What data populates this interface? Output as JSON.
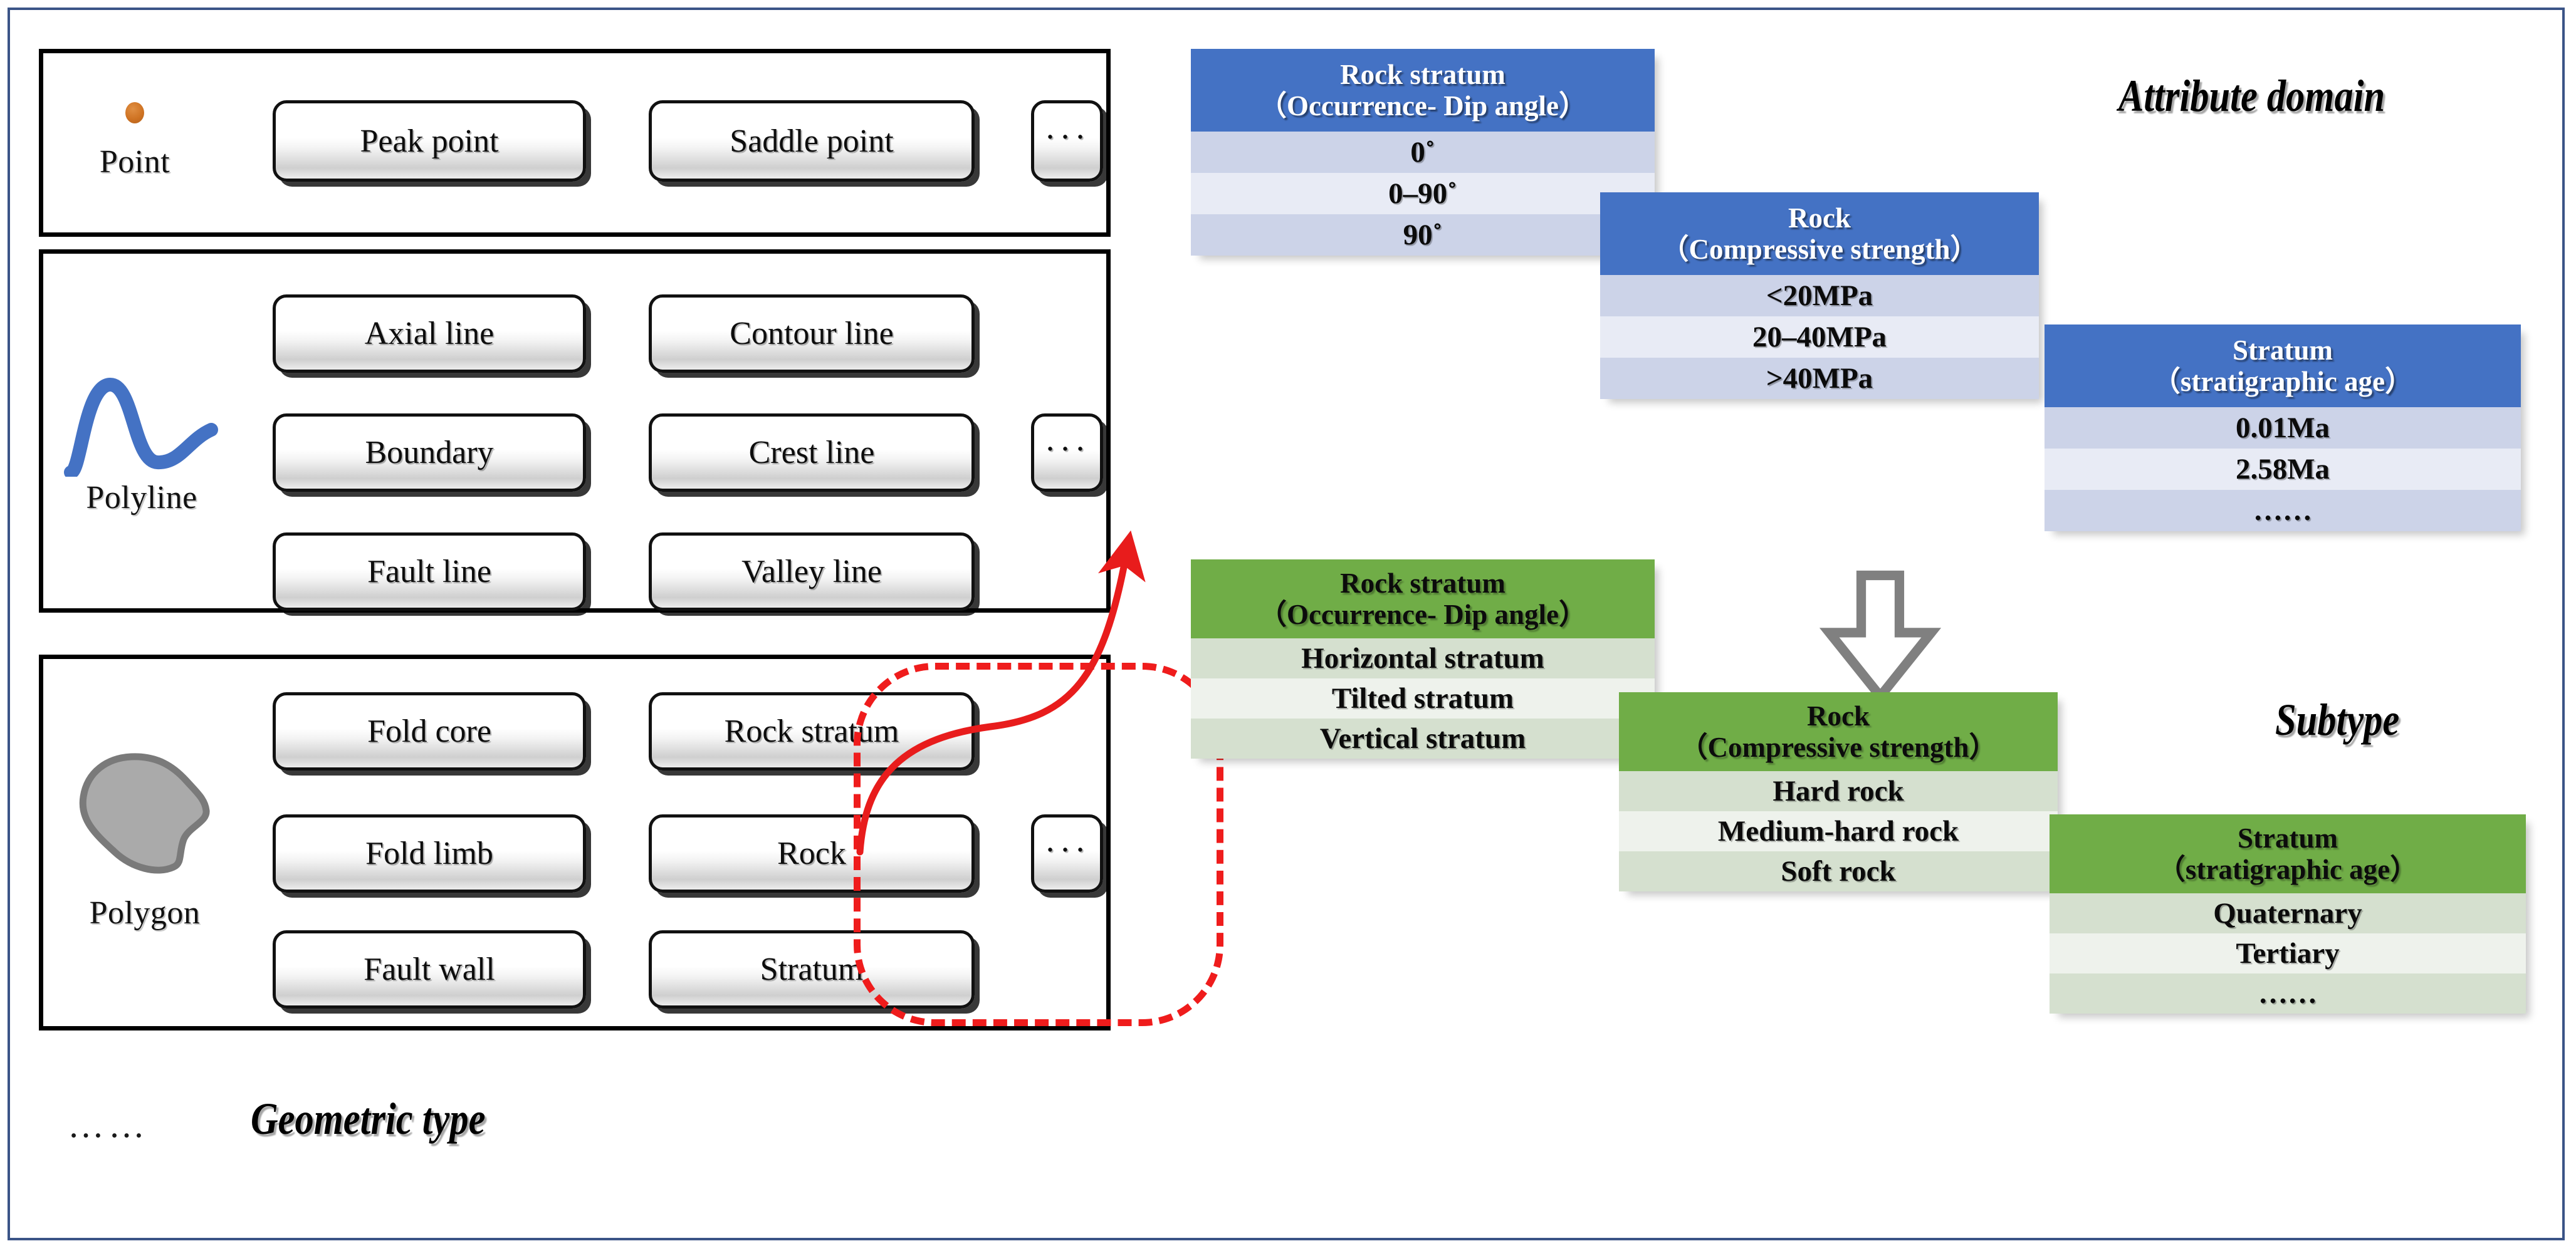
{
  "diagram": {
    "title_left": "Geometric type",
    "title_attribute": "Attribute domain",
    "title_subtype": "Subtype",
    "left_ellipsis": "……",
    "accent_blue": "#4472C4",
    "accent_green": "#70AD47",
    "highlight_red": "#EF1C1C",
    "frame_blue": "#3B5487"
  },
  "geometry_groups": [
    {
      "id": "point",
      "caption": "Point",
      "icon": "orange-dot-icon",
      "items": [
        "Peak point",
        "Saddle point"
      ],
      "more": "···"
    },
    {
      "id": "polyline",
      "caption": "Polyline",
      "icon": "blue-wave-icon",
      "items": [
        "Axial line",
        "Contour line",
        "Boundary",
        "Crest line",
        "Fault line",
        "Valley line"
      ],
      "more": "···"
    },
    {
      "id": "polygon",
      "caption": "Polygon",
      "icon": "gray-blob-icon",
      "items": [
        "Fold core",
        "Rock stratum",
        "Fold limb",
        "Rock",
        "Fault wall",
        "Stratum"
      ],
      "more": "···"
    }
  ],
  "attribute_domain": {
    "heading": "Attribute domain",
    "tables": [
      {
        "header_line1": "Rock stratum",
        "header_line2": "（Occurrence- Dip angle）",
        "rows": [
          "0˚",
          "0–90˚",
          "90˚"
        ]
      },
      {
        "header_line1": "Rock",
        "header_line2": "（Compressive strength）",
        "rows": [
          "<20MPa",
          "20–40MPa",
          ">40MPa"
        ]
      },
      {
        "header_line1": "Stratum",
        "header_line2": "（stratigraphic age）",
        "rows": [
          "0.01Ma",
          "2.58Ma",
          "……"
        ]
      }
    ]
  },
  "subtype": {
    "heading": "Subtype",
    "tables": [
      {
        "header_line1": "Rock stratum",
        "header_line2": "（Occurrence- Dip angle）",
        "rows": [
          "Horizontal stratum",
          "Tilted stratum",
          "Vertical stratum"
        ]
      },
      {
        "header_line1": "Rock",
        "header_line2": "（Compressive strength）",
        "rows": [
          "Hard rock",
          "Medium-hard rock",
          "Soft rock"
        ]
      },
      {
        "header_line1": "Stratum",
        "header_line2": "（stratigraphic age）",
        "rows": [
          "Quaternary",
          "Tertiary",
          "……"
        ]
      }
    ]
  },
  "connectors": {
    "red_curve": "red-curved-arrow",
    "gray_arrow": "gray-down-arrow"
  }
}
